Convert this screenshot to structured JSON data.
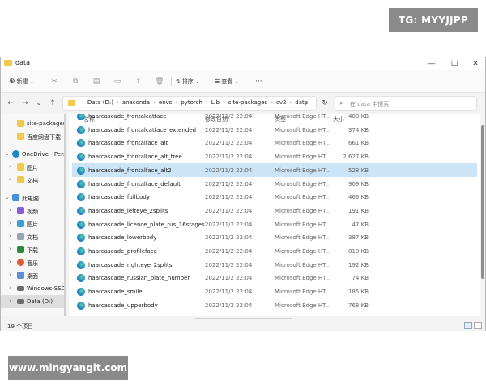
{
  "watermarks": {
    "top": "TG: MYYJJPP",
    "bottom": "www.mingyangit.com"
  },
  "window": {
    "title": "data",
    "minimize": "—",
    "maximize": "□",
    "close": "✕"
  },
  "toolbar": {
    "new_label": "新建",
    "sort_label": "排序",
    "view_label": "查看",
    "more_label": "···"
  },
  "address": {
    "crumbs": [
      "Data (D:)",
      "anaconda",
      "envs",
      "pytorch",
      "Lib",
      "site-packages",
      "cv2",
      "data"
    ],
    "search_placeholder": "在 data 中搜索"
  },
  "sidebar": {
    "items": [
      {
        "label": "site-packages"
      },
      {
        "label": "百度网盘下载"
      },
      {
        "label": "OneDrive - Pers"
      },
      {
        "label": "图片"
      },
      {
        "label": "文档"
      },
      {
        "label": "此电脑"
      },
      {
        "label": "视频"
      },
      {
        "label": "图片"
      },
      {
        "label": "文档"
      },
      {
        "label": "下载"
      },
      {
        "label": "音乐"
      },
      {
        "label": "桌面"
      },
      {
        "label": "Windows-SSD"
      },
      {
        "label": "Data (D:)"
      }
    ]
  },
  "columns": {
    "name": "名称",
    "modified": "修改日期",
    "type": "类型",
    "size": "大小"
  },
  "files": [
    {
      "name": "haarcascade_frontalcatface",
      "modified": "2022/11/2 22:04",
      "type": "Microsoft Edge HT...",
      "size": "400 KB"
    },
    {
      "name": "haarcascade_frontalcatface_extended",
      "modified": "2022/11/2 22:04",
      "type": "Microsoft Edge HT...",
      "size": "374 KB"
    },
    {
      "name": "haarcascade_frontalface_alt",
      "modified": "2022/11/2 22:04",
      "type": "Microsoft Edge HT...",
      "size": "661 KB"
    },
    {
      "name": "haarcascade_frontalface_alt_tree",
      "modified": "2022/11/2 22:04",
      "type": "Microsoft Edge HT...",
      "size": "2,627 KB"
    },
    {
      "name": "haarcascade_frontalface_alt2",
      "modified": "2022/11/2 22:04",
      "type": "Microsoft Edge HT...",
      "size": "528 KB"
    },
    {
      "name": "haarcascade_frontalface_default",
      "modified": "2022/11/2 22:04",
      "type": "Microsoft Edge HT...",
      "size": "909 KB"
    },
    {
      "name": "haarcascade_fullbody",
      "modified": "2022/11/2 22:04",
      "type": "Microsoft Edge HT...",
      "size": "466 KB"
    },
    {
      "name": "haarcascade_lefteye_2splits",
      "modified": "2022/11/2 22:04",
      "type": "Microsoft Edge HT...",
      "size": "191 KB"
    },
    {
      "name": "haarcascade_licence_plate_rus_16stages",
      "modified": "2022/11/2 22:04",
      "type": "Microsoft Edge HT...",
      "size": "47 KB"
    },
    {
      "name": "haarcascade_lowerbody",
      "modified": "2022/11/2 22:04",
      "type": "Microsoft Edge HT...",
      "size": "387 KB"
    },
    {
      "name": "haarcascade_profileface",
      "modified": "2022/11/2 22:04",
      "type": "Microsoft Edge HT...",
      "size": "810 KB"
    },
    {
      "name": "haarcascade_righteye_2splits",
      "modified": "2022/11/2 22:04",
      "type": "Microsoft Edge HT...",
      "size": "192 KB"
    },
    {
      "name": "haarcascade_russian_plate_number",
      "modified": "2022/11/2 22:04",
      "type": "Microsoft Edge HT...",
      "size": "74 KB"
    },
    {
      "name": "haarcascade_smile",
      "modified": "2022/11/2 22:04",
      "type": "Microsoft Edge HT...",
      "size": "185 KB"
    },
    {
      "name": "haarcascade_upperbody",
      "modified": "2022/11/2 22:04",
      "type": "Microsoft Edge HT...",
      "size": "768 KB"
    }
  ],
  "selected_file_index": 4,
  "status": {
    "count_text": "19 个项目"
  },
  "colors": {
    "selection": "#cce4f7",
    "folder": "#f2c94c",
    "accent": "#1e86c8"
  }
}
